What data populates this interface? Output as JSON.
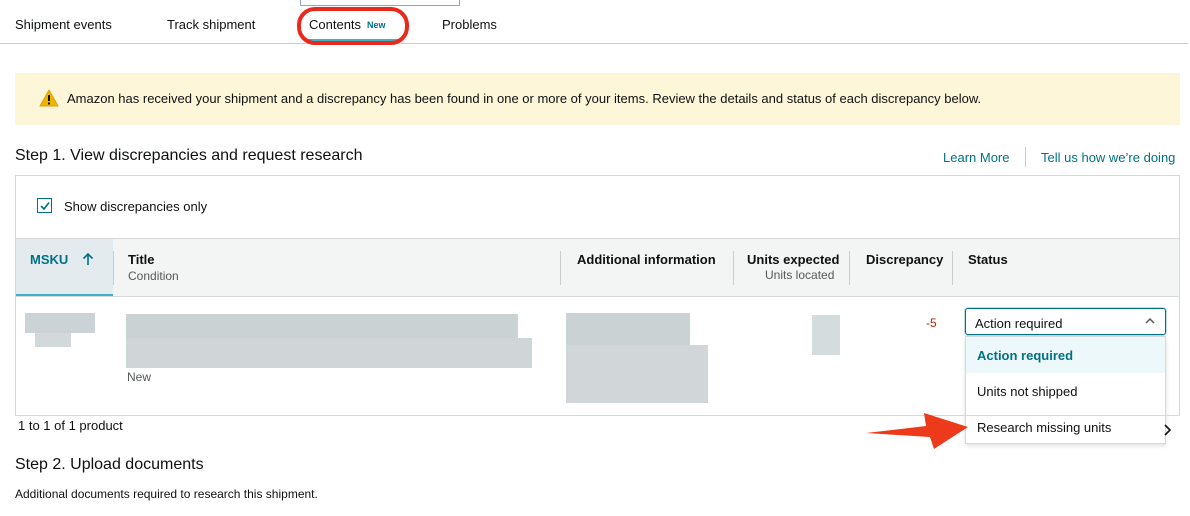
{
  "tabs": [
    {
      "label": "Shipment events"
    },
    {
      "label": "Track shipment"
    },
    {
      "label": "Contents",
      "badge": "New"
    },
    {
      "label": "Problems"
    }
  ],
  "alert": {
    "icon": "warning-icon",
    "message": "Amazon has received your shipment and a discrepancy has been found in one or more of your items. Review the details and status of each discrepancy below."
  },
  "step1": {
    "title": "Step 1. View discrepancies and request research",
    "links": [
      "Learn More",
      "Tell us how we’re doing"
    ]
  },
  "filter": {
    "label": "Show discrepancies only",
    "checked": true
  },
  "table": {
    "columns": {
      "msku": "MSKU",
      "title": "Title",
      "title_sub": "Condition",
      "additional": "Additional information",
      "units_expected": "Units expected",
      "units_located": "Units located",
      "discrepancy": "Discrepancy",
      "status": "Status"
    },
    "row": {
      "condition": "New",
      "discrepancy": "-5",
      "status": "Action required"
    },
    "status_options": [
      "Action required",
      "Units not shipped",
      "Research missing units"
    ],
    "pagination": "1 to 1 of 1 product"
  },
  "step2": {
    "title": "Step 2. Upload documents",
    "description": "Additional documents required to research this shipment."
  },
  "colors": {
    "accent": "#007185",
    "alert_bg": "#fef6d9",
    "highlight": "#e8291c",
    "discrepancy": "#b12704"
  }
}
